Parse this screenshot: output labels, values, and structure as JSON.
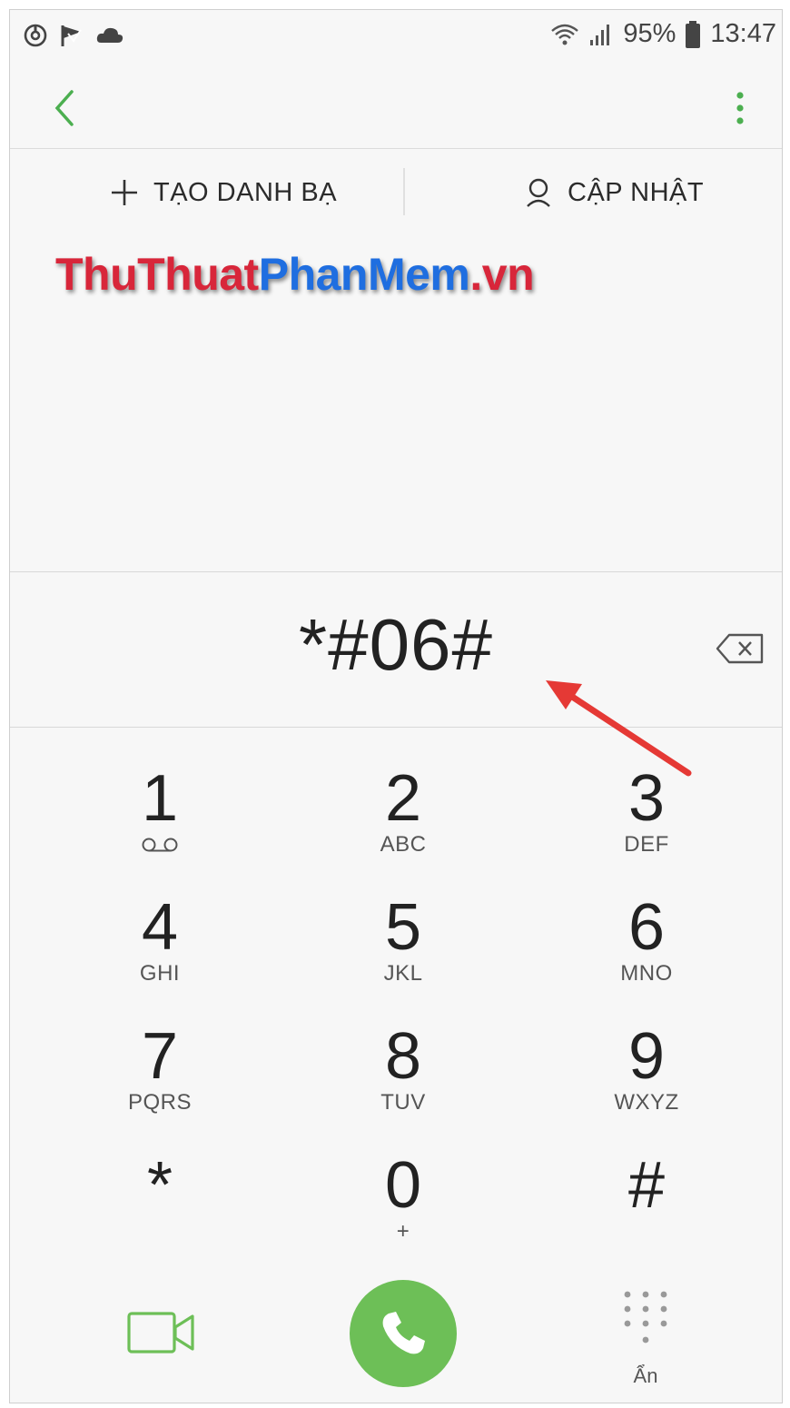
{
  "status_bar": {
    "battery_percent": "95%",
    "time": "13:47",
    "left_icons": [
      "sync-icon",
      "flag-icon",
      "cloud-icon"
    ],
    "right_icons": [
      "wifi-icon",
      "signal-icon",
      "battery-icon"
    ]
  },
  "app_bar": {
    "back_icon": "chevron-left-icon",
    "more_icon": "more-vertical-icon",
    "accent_color": "#4caf50"
  },
  "actions": {
    "create_contact": "TẠO DANH BẠ",
    "update": "CẬP NHẬT"
  },
  "watermark": {
    "part1": "ThuThuat",
    "part2": "PhanMem",
    "part3": ".vn"
  },
  "dial": {
    "number": "*#06#"
  },
  "keypad": {
    "keys": [
      {
        "digit": "1",
        "letters": ""
      },
      {
        "digit": "2",
        "letters": "ABC"
      },
      {
        "digit": "3",
        "letters": "DEF"
      },
      {
        "digit": "4",
        "letters": "GHI"
      },
      {
        "digit": "5",
        "letters": "JKL"
      },
      {
        "digit": "6",
        "letters": "MNO"
      },
      {
        "digit": "7",
        "letters": "PQRS"
      },
      {
        "digit": "8",
        "letters": "TUV"
      },
      {
        "digit": "9",
        "letters": "WXYZ"
      },
      {
        "digit": "*",
        "letters": ""
      },
      {
        "digit": "0",
        "letters": "+"
      },
      {
        "digit": "#",
        "letters": ""
      }
    ]
  },
  "bottom_bar": {
    "hide_label": "Ẩn",
    "call_color": "#6dbf57"
  }
}
